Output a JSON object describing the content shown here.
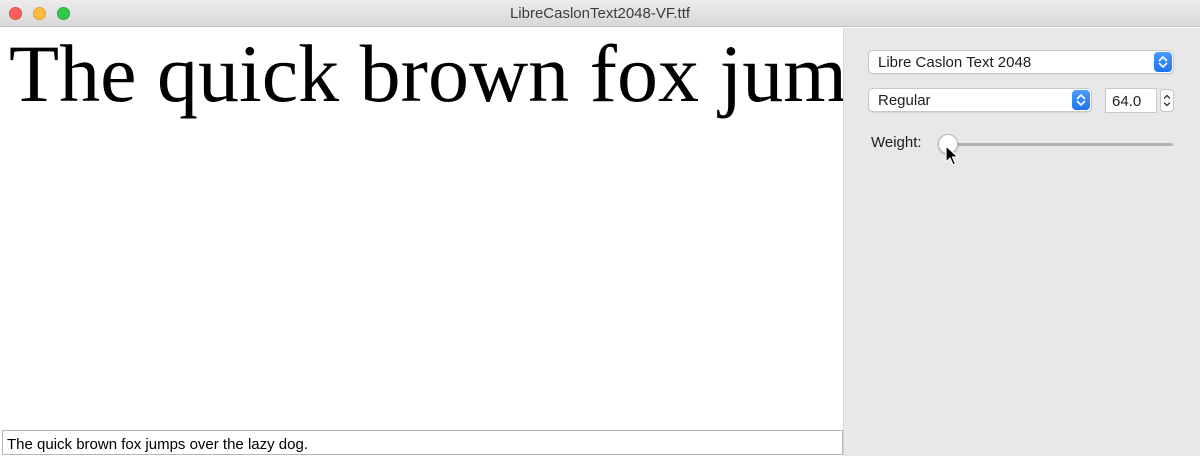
{
  "window": {
    "title": "LibreCaslonText2048-VF.ttf"
  },
  "preview": {
    "text": "The quick brown fox jumps over the lazy dog."
  },
  "sample_field": {
    "value": "The quick brown fox jumps over the lazy dog."
  },
  "inspector": {
    "font_popup": {
      "value": "Libre Caslon Text 2048"
    },
    "style_popup": {
      "value": "Regular"
    },
    "size_field": {
      "value": "64.0"
    },
    "weight": {
      "label": "Weight:",
      "value_fraction": 0.0
    }
  },
  "colors": {
    "accent": "#1f73ef",
    "close": "#fc605b",
    "minimize": "#fdbc40",
    "maximize": "#34c84a",
    "panel": "#e8e7ea"
  },
  "icons": [
    "close-window-icon",
    "minimize-window-icon",
    "maximize-window-icon",
    "chevron-up-down-icon",
    "stepper-icon",
    "mouse-pointer-icon"
  ]
}
